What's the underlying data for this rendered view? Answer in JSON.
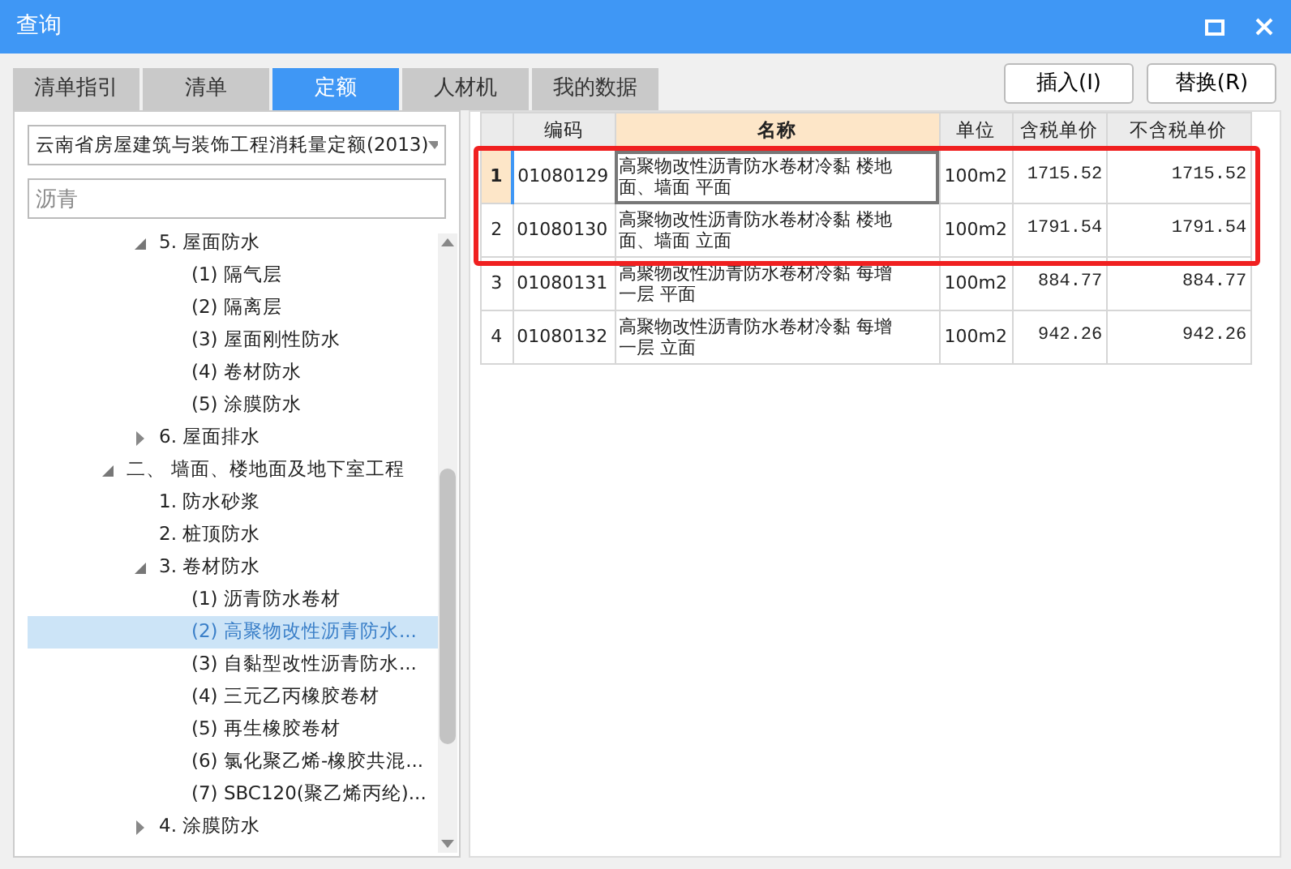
{
  "window": {
    "title": "查询"
  },
  "tabs": [
    {
      "label": "清单指引",
      "selected": false
    },
    {
      "label": "清单",
      "selected": false
    },
    {
      "label": "定额",
      "selected": true
    },
    {
      "label": "人材机",
      "selected": false
    },
    {
      "label": "我的数据",
      "selected": false
    }
  ],
  "library_select": {
    "value": "云南省房屋建筑与装饰工程消耗量定额(2013)"
  },
  "search": {
    "value": "沥青"
  },
  "tree": [
    {
      "children": [
        {
          "label": "5. 屋面防水",
          "expanded": true,
          "selected": false,
          "children": [
            {
              "label": "(1) 隔气层",
              "selected": false
            },
            {
              "label": "(2) 隔离层",
              "selected": false
            },
            {
              "label": "(3) 屋面刚性防水",
              "selected": false
            },
            {
              "label": "(4) 卷材防水",
              "selected": false
            },
            {
              "label": "(5) 涂膜防水",
              "selected": false
            }
          ]
        },
        {
          "label": "6. 屋面排水",
          "expanded": false,
          "selected": false
        }
      ]
    },
    {
      "label": "二、 墙面、楼地面及地下室工程",
      "expanded": true,
      "selected": false,
      "children": [
        {
          "label": "1. 防水砂浆",
          "selected": false
        },
        {
          "label": "2. 桩顶防水",
          "selected": false
        },
        {
          "label": "3. 卷材防水",
          "expanded": true,
          "selected": false,
          "children": [
            {
              "label": "(1) 沥青防水卷材",
              "selected": false
            },
            {
              "label": "(2) 高聚物改性沥青防水...",
              "selected": true
            },
            {
              "label": "(3) 自黏型改性沥青防水...",
              "selected": false
            },
            {
              "label": "(4) 三元乙丙橡胶卷材",
              "selected": false
            },
            {
              "label": "(5) 再生橡胶卷材",
              "selected": false
            },
            {
              "label": "(6) 氯化聚乙烯-橡胶共混...",
              "selected": false
            },
            {
              "label": "(7) SBC120(聚乙烯丙纶)...",
              "selected": false
            }
          ]
        },
        {
          "label": "4. 涂膜防水",
          "expanded": false,
          "selected": false
        }
      ]
    }
  ],
  "buttons": [
    {
      "label": "插入(I)"
    },
    {
      "label": "替换(R)"
    }
  ],
  "table": {
    "columns": [
      "编码",
      "名称",
      "单位",
      "含税单价",
      "不含税单价"
    ],
    "rows": [
      {
        "number": "1",
        "code": "01080129",
        "name": "高聚物改性沥青防水卷材冷黏 楼地面、墙面 平面",
        "unit": "100m2",
        "price_tax": "1715.52",
        "price_no_tax": "1715.52",
        "selected": true,
        "highlighted": true
      },
      {
        "number": "2",
        "code": "01080130",
        "name": "高聚物改性沥青防水卷材冷黏 楼地面、墙面 立面",
        "unit": "100m2",
        "price_tax": "1791.54",
        "price_no_tax": "1791.54",
        "selected": false,
        "highlighted": true
      },
      {
        "number": "3",
        "code": "01080131",
        "name": "高聚物改性沥青防水卷材冷黏 每增一层 平面",
        "unit": "100m2",
        "price_tax": "884.77",
        "price_no_tax": "884.77",
        "selected": false,
        "highlighted": false
      },
      {
        "number": "4",
        "code": "01080132",
        "name": "高聚物改性沥青防水卷材冷黏 每增一层 立面",
        "unit": "100m2",
        "price_tax": "942.26",
        "price_no_tax": "942.26",
        "selected": false,
        "highlighted": false
      }
    ]
  }
}
